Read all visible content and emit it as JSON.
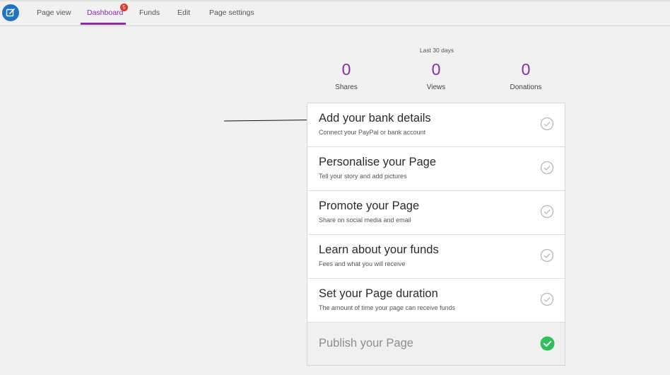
{
  "nav": {
    "items": [
      {
        "label": "Page view"
      },
      {
        "label": "Dashboard"
      },
      {
        "label": "Funds"
      },
      {
        "label": "Edit"
      },
      {
        "label": "Page settings"
      }
    ],
    "active": "Dashboard",
    "dashboard_badge": "5",
    "app_icon": "edit-icon"
  },
  "stats": {
    "period_label": "Last 30 days",
    "items": [
      {
        "value": "0",
        "label": "Shares"
      },
      {
        "value": "0",
        "label": "Views"
      },
      {
        "value": "0",
        "label": "Donations"
      }
    ]
  },
  "steps": [
    {
      "title": "Add your bank details",
      "subtitle": "Connect your PayPal or bank account",
      "icon": "check-circle-outline-icon"
    },
    {
      "title": "Personalise your Page",
      "subtitle": "Tell your story and add pictures",
      "icon": "check-circle-outline-icon"
    },
    {
      "title": "Promote your Page",
      "subtitle": "Share on social media and email",
      "icon": "check-circle-outline-icon"
    },
    {
      "title": "Learn about your funds",
      "subtitle": "Fees and what you will receive",
      "icon": "check-circle-outline-icon"
    },
    {
      "title": "Set your Page duration",
      "subtitle": "The amount of time your page can receive funds",
      "icon": "check-circle-outline-icon"
    }
  ],
  "publish": {
    "title": "Publish your Page",
    "icon": "check-circle-filled-icon"
  },
  "colors": {
    "accent": "#8e2aa6",
    "app_icon_bg": "#1f74c7",
    "badge": "#e0342b",
    "success": "#2ec15a",
    "check_outline": "#b8b8b8"
  }
}
